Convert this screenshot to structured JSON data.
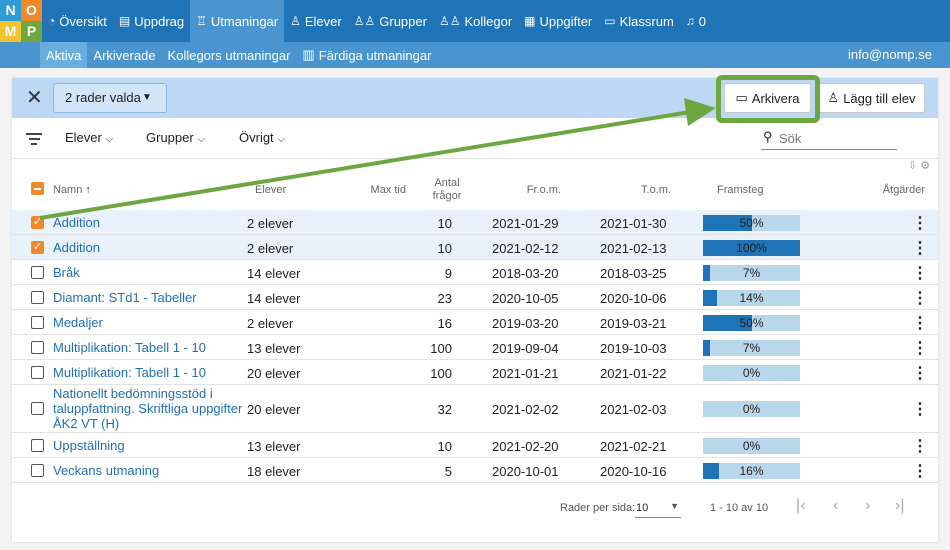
{
  "logo": {
    "letters": [
      "N",
      "O",
      "M",
      "P"
    ]
  },
  "nav": {
    "items": [
      {
        "label": "Översikt",
        "icon": "gauge-icon"
      },
      {
        "label": "Uppdrag",
        "icon": "book-icon"
      },
      {
        "label": "Utmaningar",
        "icon": "trophy-icon",
        "active": true
      },
      {
        "label": "Elever",
        "icon": "user-icon"
      },
      {
        "label": "Grupper",
        "icon": "users-icon"
      },
      {
        "label": "Kollegor",
        "icon": "colleagues-icon"
      },
      {
        "label": "Uppgifter",
        "icon": "grid-icon"
      },
      {
        "label": "Klassrum",
        "icon": "classroom-icon"
      }
    ],
    "notifications": "0"
  },
  "subnav": {
    "items": [
      {
        "label": "Aktiva",
        "active": true
      },
      {
        "label": "Arkiverade"
      },
      {
        "label": "Kollegors utmaningar"
      },
      {
        "label": "Färdiga utmaningar",
        "icon": "book-shelf-icon"
      }
    ],
    "email": "info@nomp.se"
  },
  "selection": {
    "rows_selected": "2 rader valda",
    "archive_label": "Arkivera",
    "add_student_label": "Lägg till elev"
  },
  "filters": {
    "items": [
      "Elever",
      "Grupper",
      "Övrigt"
    ],
    "search_placeholder": "Sök"
  },
  "table": {
    "headers": {
      "name": "Namn",
      "students": "Elever",
      "max_time": "Max tid",
      "question_count": [
        "Antal",
        "frågor"
      ],
      "from": "Fr.o.m.",
      "to": "T.o.m.",
      "progress": "Framsteg",
      "actions": "Åtgärder"
    },
    "rows": [
      {
        "name": [
          "Addition"
        ],
        "students": "2 elever",
        "questions": "10",
        "from": "2021-01-29",
        "to": "2021-01-30",
        "progress": 50,
        "progress_label": "50%",
        "selected": true
      },
      {
        "name": [
          "Addition"
        ],
        "students": "2 elever",
        "questions": "10",
        "from": "2021-02-12",
        "to": "2021-02-13",
        "progress": 100,
        "progress_label": "100%",
        "selected": true
      },
      {
        "name": [
          "Bråk"
        ],
        "students": "14 elever",
        "questions": "9",
        "from": "2018-03-20",
        "to": "2018-03-25",
        "progress": 7,
        "progress_label": "7%",
        "selected": false
      },
      {
        "name": [
          "Diamant: STd1 - Tabeller"
        ],
        "students": "14 elever",
        "questions": "23",
        "from": "2020-10-05",
        "to": "2020-10-06",
        "progress": 14,
        "progress_label": "14%",
        "selected": false
      },
      {
        "name": [
          "Medaljer"
        ],
        "students": "2 elever",
        "questions": "16",
        "from": "2019-03-20",
        "to": "2019-03-21",
        "progress": 50,
        "progress_label": "50%",
        "selected": false
      },
      {
        "name": [
          "Multiplikation: Tabell 1 - 10"
        ],
        "students": "13 elever",
        "questions": "100",
        "from": "2019-09-04",
        "to": "2019-10-03",
        "progress": 7,
        "progress_label": "7%",
        "selected": false
      },
      {
        "name": [
          "Multiplikation: Tabell 1 - 10"
        ],
        "students": "20 elever",
        "questions": "100",
        "from": "2021-01-21",
        "to": "2021-01-22",
        "progress": 0,
        "progress_label": "0%",
        "selected": false
      },
      {
        "name": [
          "Nationellt bedömningsstöd i",
          "taluppfattning. Skriftliga uppgifter",
          "ÅK2 VT (H)"
        ],
        "students": "20 elever",
        "questions": "32",
        "from": "2021-02-02",
        "to": "2021-02-03",
        "progress": 0,
        "progress_label": "0%",
        "selected": false
      },
      {
        "name": [
          "Uppställning"
        ],
        "students": "13 elever",
        "questions": "10",
        "from": "2021-02-20",
        "to": "2021-02-21",
        "progress": 0,
        "progress_label": "0%",
        "selected": false
      },
      {
        "name": [
          "Veckans utmaning"
        ],
        "students": "18 elever",
        "questions": "5",
        "from": "2020-10-01",
        "to": "2020-10-16",
        "progress": 16,
        "progress_label": "16%",
        "selected": false
      }
    ]
  },
  "pagination": {
    "rows_per_page_label": "Rader per sida:",
    "rows_per_page": "10",
    "range": "1 - 10 av 10"
  },
  "colors": {
    "nav": "#1f73b7",
    "subnav": "#4a95cf",
    "selection_bar": "#bcd8f5",
    "checkbox": "#ef8a2b",
    "progress_fill": "#1f73b7",
    "progress_track": "#b9d7ea",
    "annotation": "#6ea640"
  }
}
